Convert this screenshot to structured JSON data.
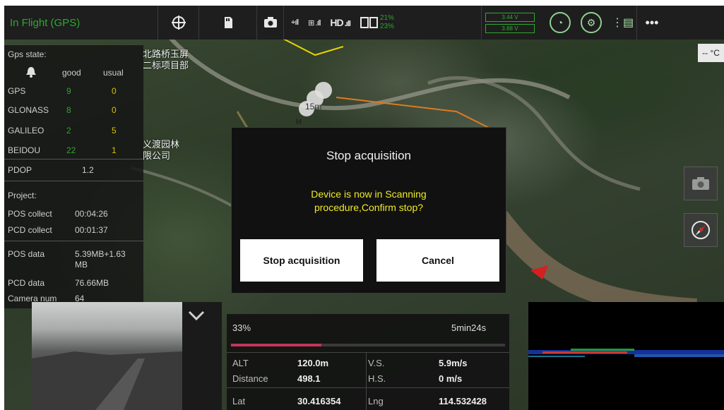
{
  "topbar": {
    "status": "In Flight (GPS)",
    "battery_1": "21%",
    "battery_2": "23%",
    "voltage_1": "3.44 V",
    "voltage_2": "3.88 V",
    "hd_label": "HD"
  },
  "map": {
    "label_1": "北路桥玉屏",
    "label_2": "二标项目部",
    "label_3": "义渡园林",
    "label_4": "限公司",
    "altitude_marker": "15m",
    "home_marker": "H",
    "temperature": "-- °C"
  },
  "gps": {
    "title": "Gps state:",
    "col_good": "good",
    "col_usual": "usual",
    "rows": [
      {
        "name": "GPS",
        "good": "9",
        "usual": "0"
      },
      {
        "name": "GLONASS",
        "good": "8",
        "usual": "0"
      },
      {
        "name": "GALILEO",
        "good": "2",
        "usual": "5"
      },
      {
        "name": "BEIDOU",
        "good": "22",
        "usual": "1"
      }
    ],
    "pdop_label": "PDOP",
    "pdop_value": "1.2"
  },
  "project": {
    "title": "Project:",
    "pos_collect_label": "POS collect",
    "pos_collect_value": "00:04:26",
    "pcd_collect_label": "PCD collect",
    "pcd_collect_value": "00:01:37",
    "pos_data_label": "POS data",
    "pos_data_value_1": "5.39MB+1.63",
    "pos_data_value_2": "MB",
    "pcd_data_label": "PCD data",
    "pcd_data_value": "76.66MB",
    "camera_num_label": "Camera num",
    "camera_num_value": "64"
  },
  "dialog": {
    "title": "Stop acquisition",
    "message_line1": "Device is now in Scanning",
    "message_line2": "procedure,Confirm stop?",
    "confirm_label": "Stop acquisition",
    "cancel_label": "Cancel"
  },
  "flight": {
    "progress_percent": "33%",
    "progress_fraction": 0.33,
    "time_remaining": "5min24s",
    "alt_label": "ALT",
    "alt_value": "120.0m",
    "vs_label": "V.S.",
    "vs_value": "5.9m/s",
    "distance_label": "Distance",
    "distance_value": "498.1",
    "hs_label": "H.S.",
    "hs_value": "0 m/s",
    "lat_label": "Lat",
    "lat_value": "30.416354",
    "lng_label": "Lng",
    "lng_value": "114.532428"
  },
  "colors": {
    "accent_green": "#2fa82f",
    "progress_red": "#c0365a",
    "warning_yellow": "#f0ea2a"
  }
}
